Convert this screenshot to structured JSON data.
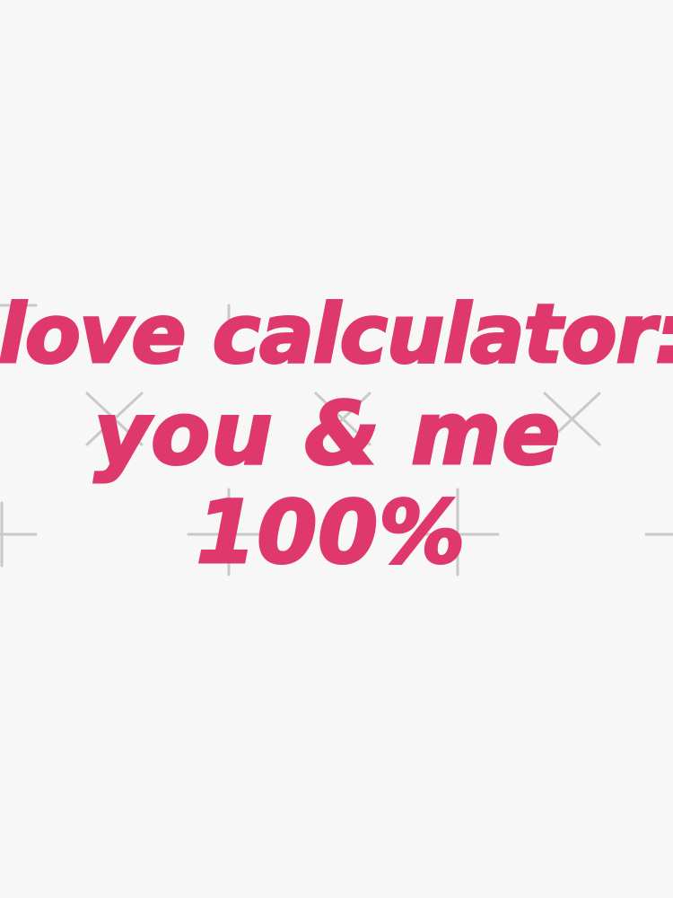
{
  "sticker": {
    "line1": "love calculator:",
    "line2": "you & me",
    "line3": "100%"
  },
  "colors": {
    "text": "#df386c",
    "background": "#f7f7f7",
    "watermark": "#c9c9c9"
  }
}
